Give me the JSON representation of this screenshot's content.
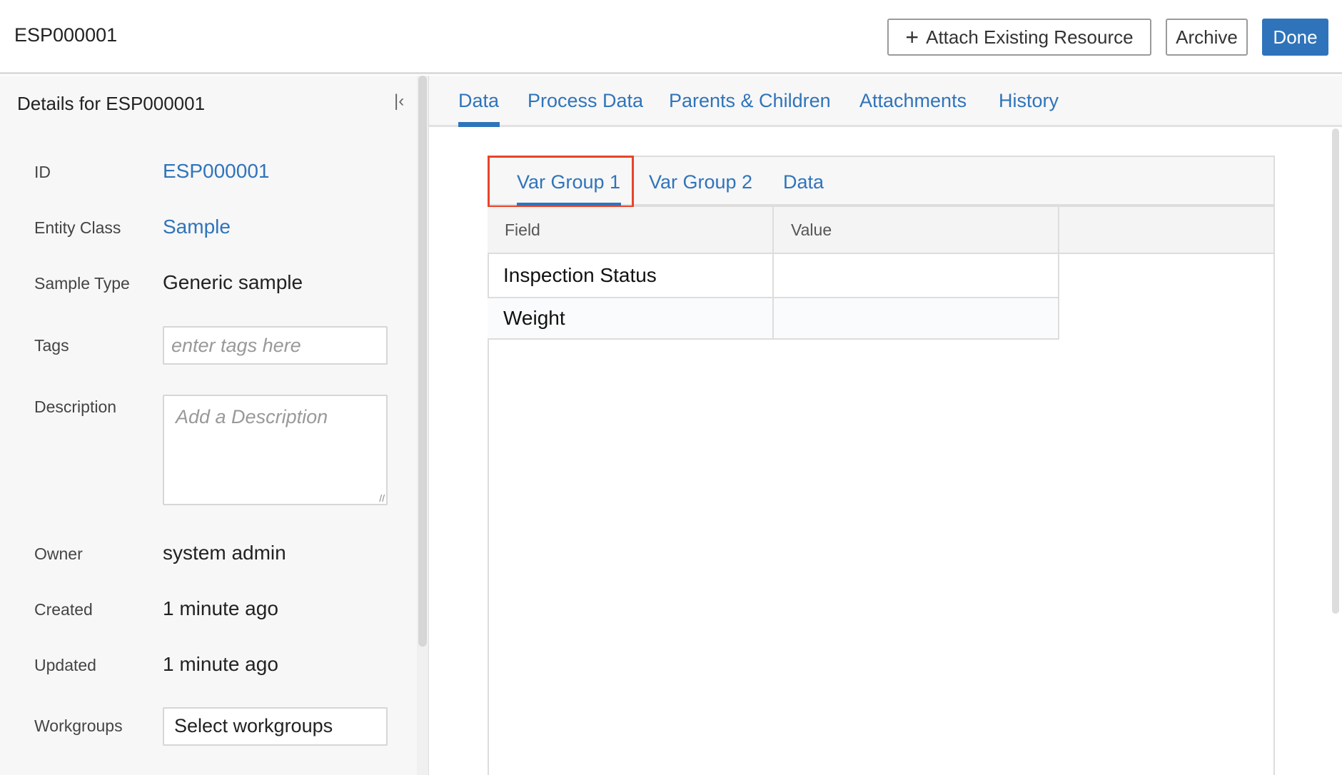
{
  "header": {
    "title": "ESP000001",
    "attach_label": "Attach Existing Resource",
    "archive_label": "Archive",
    "done_label": "Done"
  },
  "details": {
    "title": "Details for ESP000001",
    "fields": {
      "id": {
        "label": "ID",
        "value": "ESP000001"
      },
      "entity_class": {
        "label": "Entity Class",
        "value": "Sample"
      },
      "sample_type": {
        "label": "Sample Type",
        "value": "Generic sample"
      },
      "tags": {
        "label": "Tags",
        "placeholder": "enter tags here"
      },
      "description": {
        "label": "Description",
        "placeholder": "Add a Description"
      },
      "owner": {
        "label": "Owner",
        "value": "system admin"
      },
      "created": {
        "label": "Created",
        "value": "1 minute ago"
      },
      "updated": {
        "label": "Updated",
        "value": "1 minute ago"
      },
      "workgroups": {
        "label": "Workgroups",
        "value": "Select workgroups"
      }
    }
  },
  "tabs": [
    "Data",
    "Process Data",
    "Parents & Children",
    "Attachments",
    "History"
  ],
  "subtabs": [
    "Var Group 1",
    "Var Group 2",
    "Data"
  ],
  "table": {
    "headers": [
      "Field",
      "Value"
    ],
    "rows": [
      [
        "Inspection Status",
        ""
      ],
      [
        "Weight",
        ""
      ]
    ]
  },
  "colors": {
    "accent": "#2f74bb",
    "highlight": "#e8442a"
  }
}
